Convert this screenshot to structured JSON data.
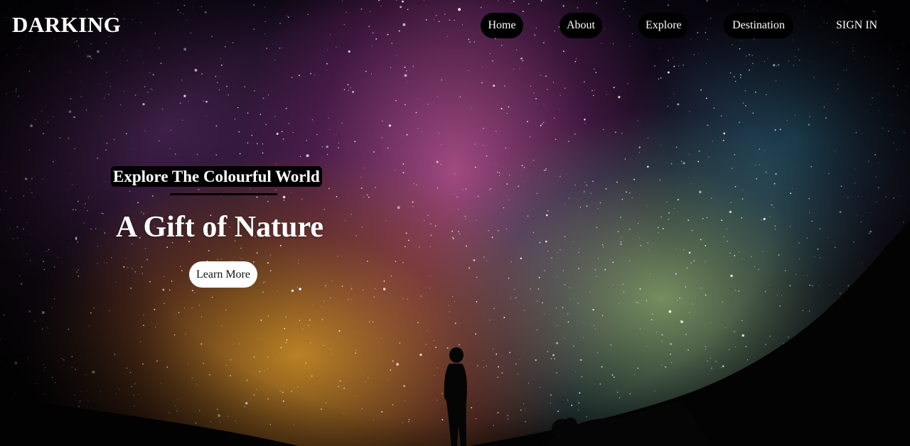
{
  "brand": {
    "logo_text": "DARKING"
  },
  "nav": {
    "home": "Home",
    "about": "About",
    "explore": "Explore",
    "destination": "Destination",
    "signin": "SIGN IN"
  },
  "hero": {
    "tagline": "Explore The Colourful World",
    "title": "A Gift of Nature",
    "cta": "Learn More"
  },
  "colors": {
    "nav_button_bg": "#000000",
    "nav_text": "#ffffff",
    "cta_bg": "#ffffff",
    "cta_text": "#111111"
  }
}
